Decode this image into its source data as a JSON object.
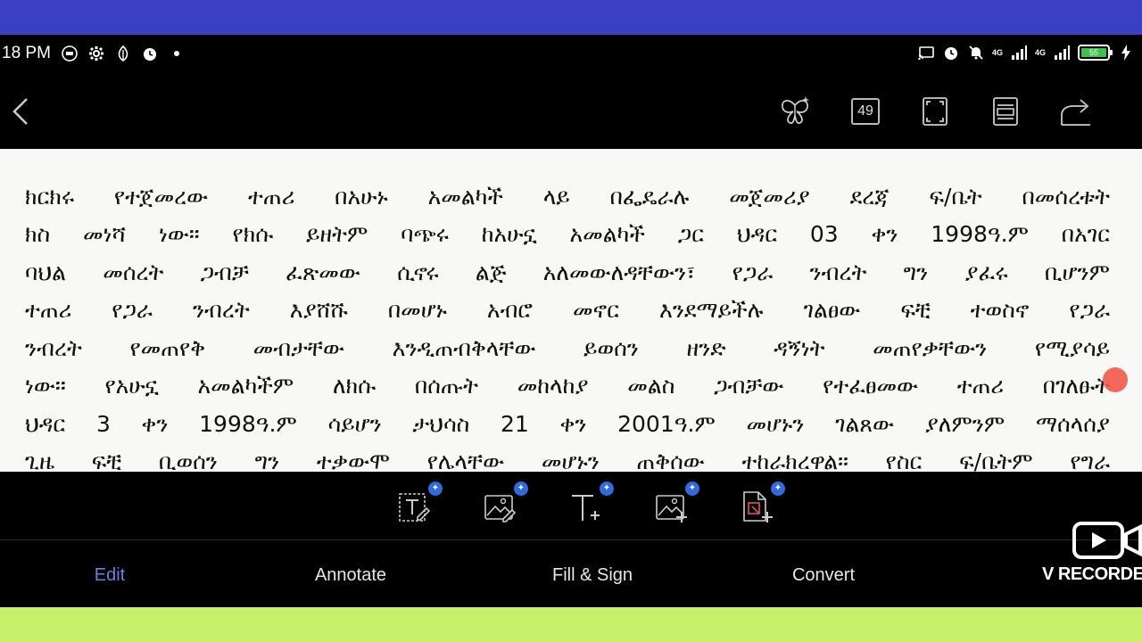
{
  "status_bar": {
    "time": "18 PM",
    "network_1": "4G",
    "network_2": "4G",
    "battery": "55"
  },
  "toolbar": {
    "page_count": "49"
  },
  "document": {
    "lines": [
      "ክርክሩ የተጀመረው ተጠሪ በአሁኑ አመልካች ላይ በፌዴራሉ መጀመሪያ ደረጃ ፍ/ቤት በመሰረቱት",
      "ክስ መነሻ ነው፡፡ የክሱ ይዘትም ባጭሩ ከአሁኗ አመልካች ጋር ህዳር 03 ቀን 1998ዓ.ም በአገር",
      "ባህል መሰረት ጋብቻ ፈጽመው ሲኖሩ ልጅ አለመውለዳቸውን፣ የጋራ ንብረት ግን ያፈሩ ቢሆንም",
      "ተጠሪ የጋራ ንብረት እያሸሹ በመሆኑ አብሮ መኖር እንደማይችሉ ገልፀው ፍቺ ተወስኖ የጋራ",
      "ንብረት የመጠየቅ መብታቸው እንዲጠብቅላቸው ይወሰን ዘንድ ዳኝነት መጠየቃቸውን የሚያሳይ",
      "ነው፡፡ የአሁኗ አመልካችም ለክሱ በሰጡት መከላከያ መልስ ጋብቻው የተፈፀመው ተጠሪ በገለፁት",
      "ህዳር 3 ቀን 1998ዓ.ም ሳይሆን ታህሳስ 21 ቀን 2001ዓ.ም መሆኑን ገልጸው ያለምንም ማሰላሰያ",
      "ጊዜ ፍቺ ቢወሰን ግን ተቃውሞ የሌላቸው መሆኑን ጠቅሰው ተከራክረዋል፡፡ የስር ፍ/ቤትም የግራ"
    ]
  },
  "tabs": [
    {
      "label": "Edit"
    },
    {
      "label": "Annotate"
    },
    {
      "label": "Fill & Sign"
    },
    {
      "label": "Convert"
    }
  ],
  "watermark": {
    "label": "V RECORDE"
  },
  "colors": {
    "accent": "#6c7fe0",
    "top_band": "#3b3fc4",
    "bottom_band": "#c7f06a",
    "scroll_handle": "#f1594a"
  }
}
